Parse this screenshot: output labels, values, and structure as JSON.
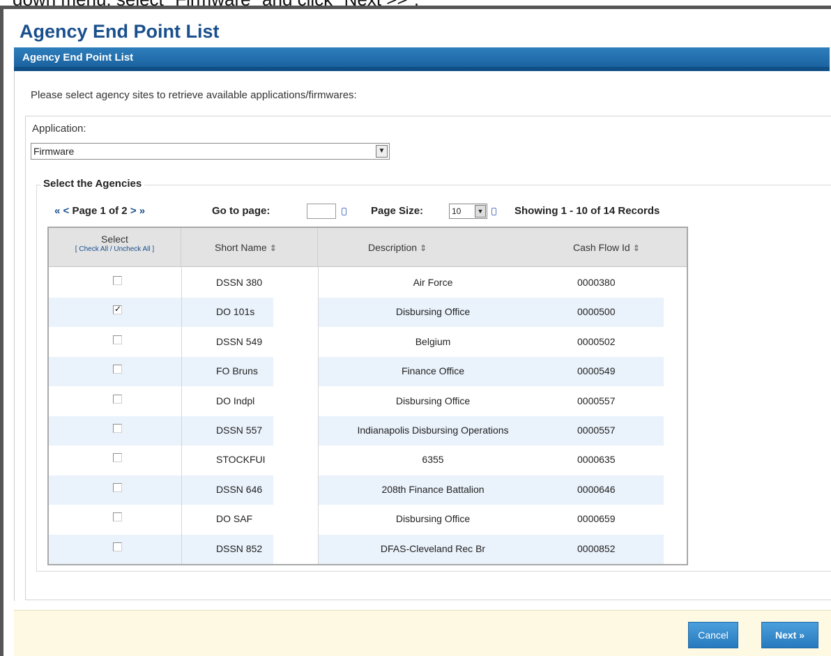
{
  "caption": "down menu, select \"Firmware\" and click \"Next >>\".",
  "page_title": "Agency End Point List",
  "panel_header": "Agency End Point List",
  "intro": "Please select agency sites to retrieve available applications/firmwares:",
  "application": {
    "label": "Application:",
    "value": "Firmware"
  },
  "agencies": {
    "legend": "Select the Agencies",
    "pager": {
      "first": "«",
      "prev": "<",
      "text": "Page 1 of 2",
      "next": ">",
      "last": "»"
    },
    "goto_label": "Go to page:",
    "page_size_label": "Page Size:",
    "page_size": "10",
    "records_text": "Showing 1 - 10 of 14 Records"
  },
  "table": {
    "headers": {
      "select": "Select",
      "check_all": "[ Check All / Uncheck All ]",
      "short_name": "Short Name",
      "description": "Description",
      "cash_flow_id": "Cash Flow Id"
    },
    "sort_glyph": "⇕",
    "check_glyph": "✓",
    "rows": [
      {
        "checked": false,
        "short": "DSSN 380",
        "desc": "Air Force",
        "cash": "0000380"
      },
      {
        "checked": true,
        "short": "DO 101s",
        "desc": "Disbursing Office",
        "cash": "0000500"
      },
      {
        "checked": false,
        "short": "DSSN 549",
        "desc": "Belgium",
        "cash": "0000502"
      },
      {
        "checked": false,
        "short": "FO Bruns",
        "desc": "Finance Office",
        "cash": "0000549"
      },
      {
        "checked": false,
        "short": "DO Indpl",
        "desc": "Disbursing Office",
        "cash": "0000557"
      },
      {
        "checked": false,
        "short": "DSSN 557",
        "desc": "Indianapolis Disbursing Operations",
        "cash": "0000557"
      },
      {
        "checked": false,
        "short": "STOCKFUI",
        "desc": "6355",
        "cash": "0000635"
      },
      {
        "checked": false,
        "short": "DSSN 646",
        "desc": "208th Finance Battalion",
        "cash": "0000646"
      },
      {
        "checked": false,
        "short": "DO SAF",
        "desc": "Disbursing Office",
        "cash": "0000659"
      },
      {
        "checked": false,
        "short": "DSSN 852",
        "desc": "DFAS-Cleveland Rec Br",
        "cash": "0000852"
      }
    ]
  },
  "buttons": {
    "cancel": "Cancel",
    "next": "Next »"
  },
  "colors": {
    "accent": "#1b62a0",
    "title": "#1a4f8e",
    "footer": "#fdf9e3"
  }
}
